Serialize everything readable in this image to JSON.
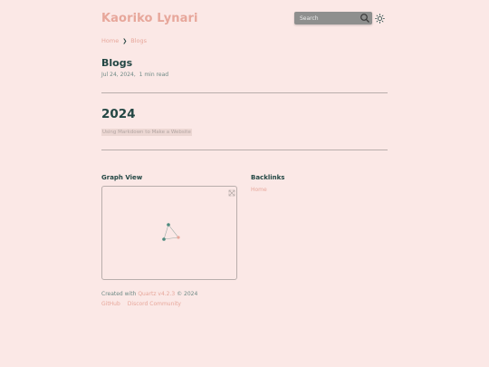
{
  "site": {
    "title": "Kaoriko Lynari"
  },
  "search": {
    "placeholder": "Search"
  },
  "breadcrumb": {
    "items": [
      "Home",
      "Blogs"
    ],
    "separator": "❯"
  },
  "page": {
    "title": "Blogs",
    "date": "Jul 24, 2024",
    "reading_time": "1 min read"
  },
  "section": {
    "year": "2024",
    "posts": [
      "Using Markdown to Make a Website"
    ]
  },
  "graph": {
    "title": "Graph View"
  },
  "backlinks": {
    "title": "Backlinks",
    "items": [
      "Home"
    ]
  },
  "footer": {
    "created_with": "Created with",
    "generator": "Quartz v4.2.3",
    "copyright": "© 2024",
    "links": [
      "GitHub",
      "Discord Community"
    ]
  },
  "colors": {
    "background": "#fbe8e6",
    "accent": "#e7a79b",
    "heading": "#234744",
    "muted": "#6f8a86",
    "graph_node": "#4d8a7e",
    "graph_node_current": "#e7a79b"
  }
}
